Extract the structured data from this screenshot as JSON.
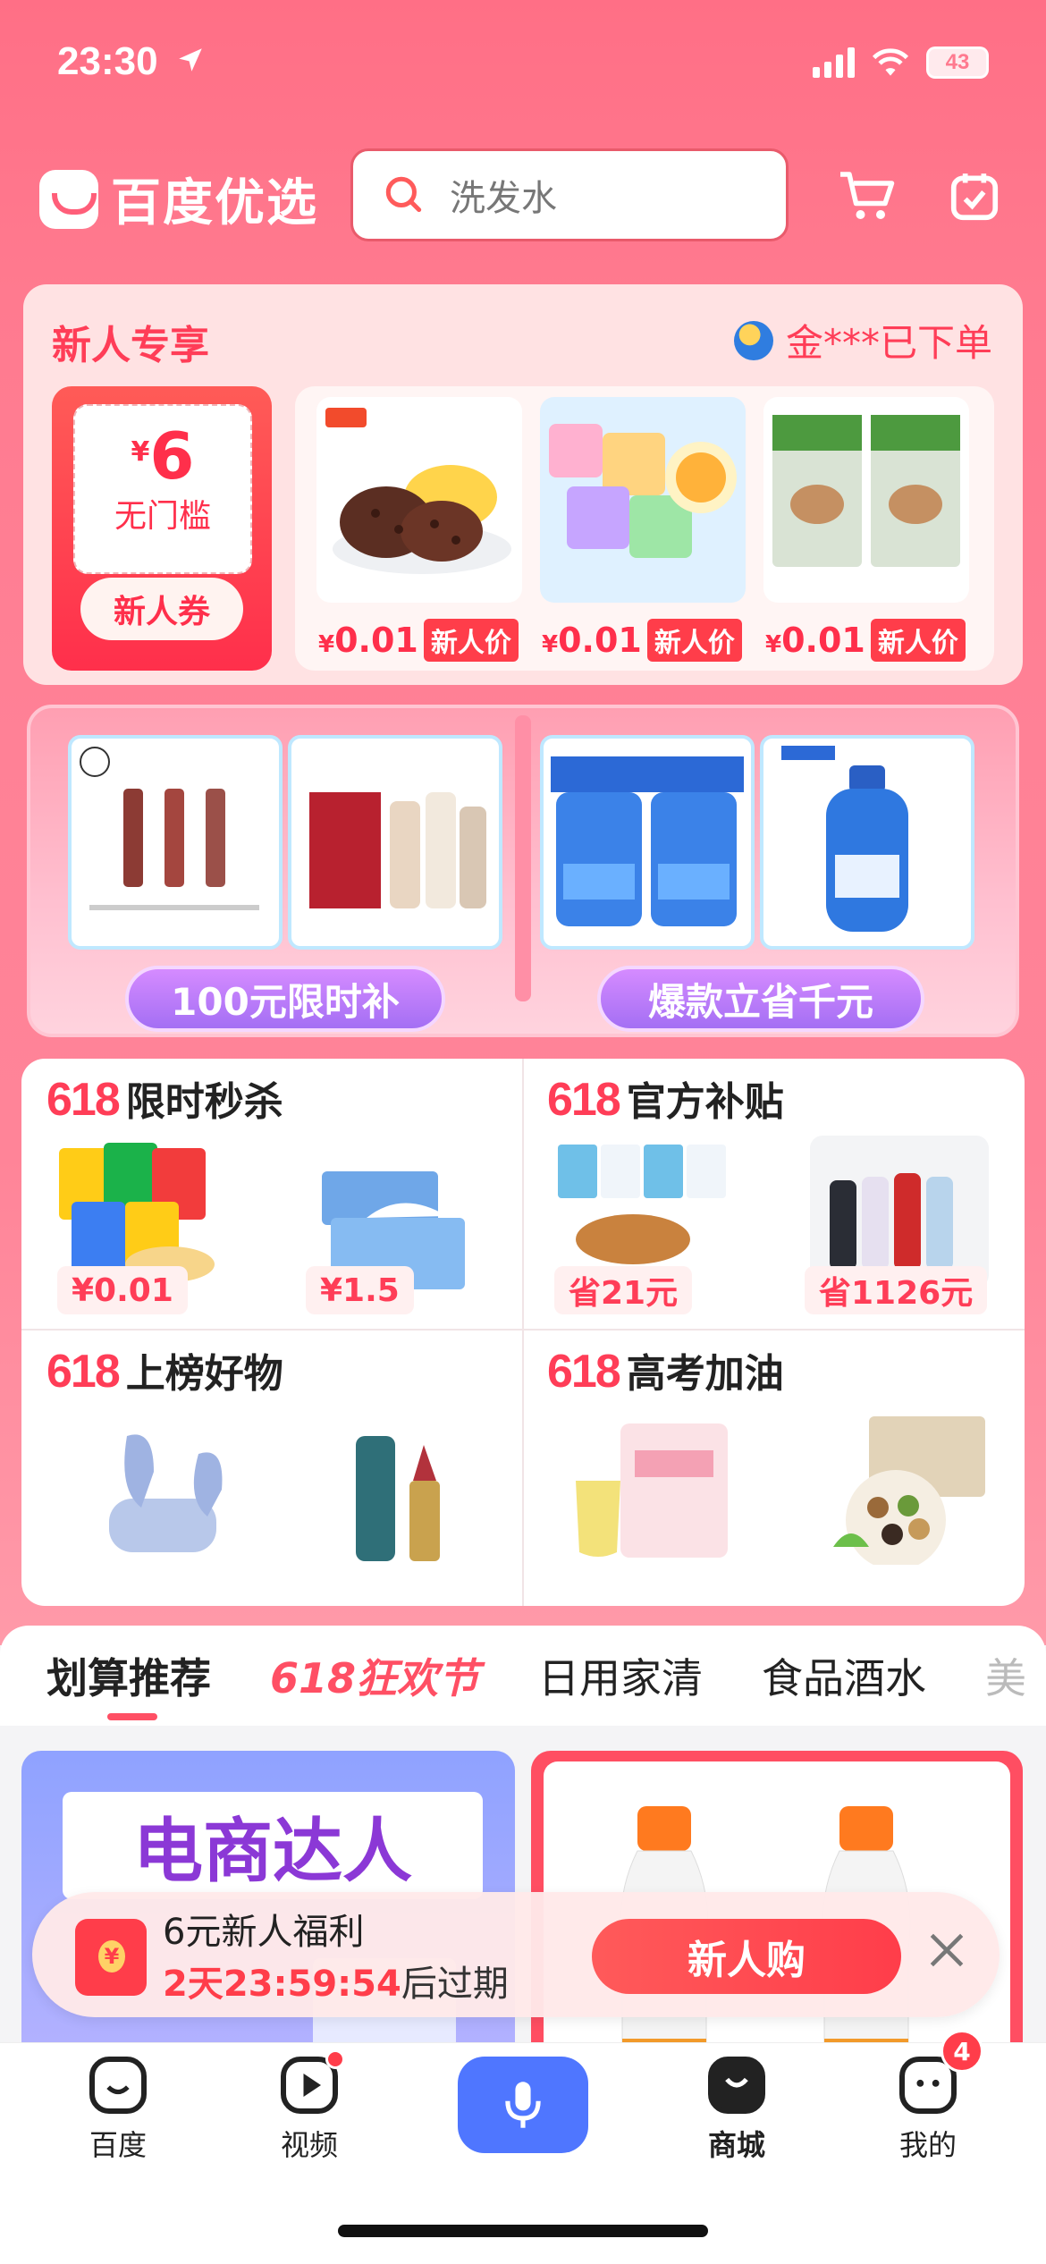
{
  "status_bar": {
    "time": "23:30",
    "battery": "43"
  },
  "header": {
    "logo": "百度优选",
    "search_placeholder": "洗发水"
  },
  "newcomer": {
    "title": "新人专享",
    "order_notice": "金***已下单",
    "coupon": {
      "currency": "¥",
      "amount": "6",
      "desc": "无门槛",
      "button": "新人券"
    },
    "goods": [
      {
        "currency": "¥",
        "price": "0.01",
        "tag": "新人价"
      },
      {
        "currency": "¥",
        "price": "0.01",
        "tag": "新人价"
      },
      {
        "currency": "¥",
        "price": "0.01",
        "tag": "新人价"
      }
    ]
  },
  "promo": {
    "left_label": "100元限时补",
    "right_label": "爆款立省千元"
  },
  "grid": [
    {
      "num": "618",
      "title": "限时秒杀",
      "badges": [
        "¥0.01",
        "¥1.5"
      ]
    },
    {
      "num": "618",
      "title": "官方补贴",
      "badges": [
        "省21元",
        "省1126元"
      ]
    },
    {
      "num": "618",
      "title": "上榜好物"
    },
    {
      "num": "618",
      "title": "高考加油"
    }
  ],
  "tabs": [
    "划算推荐",
    "618狂欢节",
    "日用家清",
    "食品酒水",
    "美"
  ],
  "feed": {
    "left_title": "电商达人"
  },
  "float_bar": {
    "title": "6元新人福利",
    "countdown": "2天23:59:54",
    "suffix": "后过期",
    "button": "新人购"
  },
  "bottom_nav": {
    "items": [
      "百度",
      "视频",
      "商城",
      "我的"
    ],
    "mine_badge": "4"
  },
  "colors": {
    "accent": "#ff3d57",
    "mic": "#4f76ff"
  }
}
